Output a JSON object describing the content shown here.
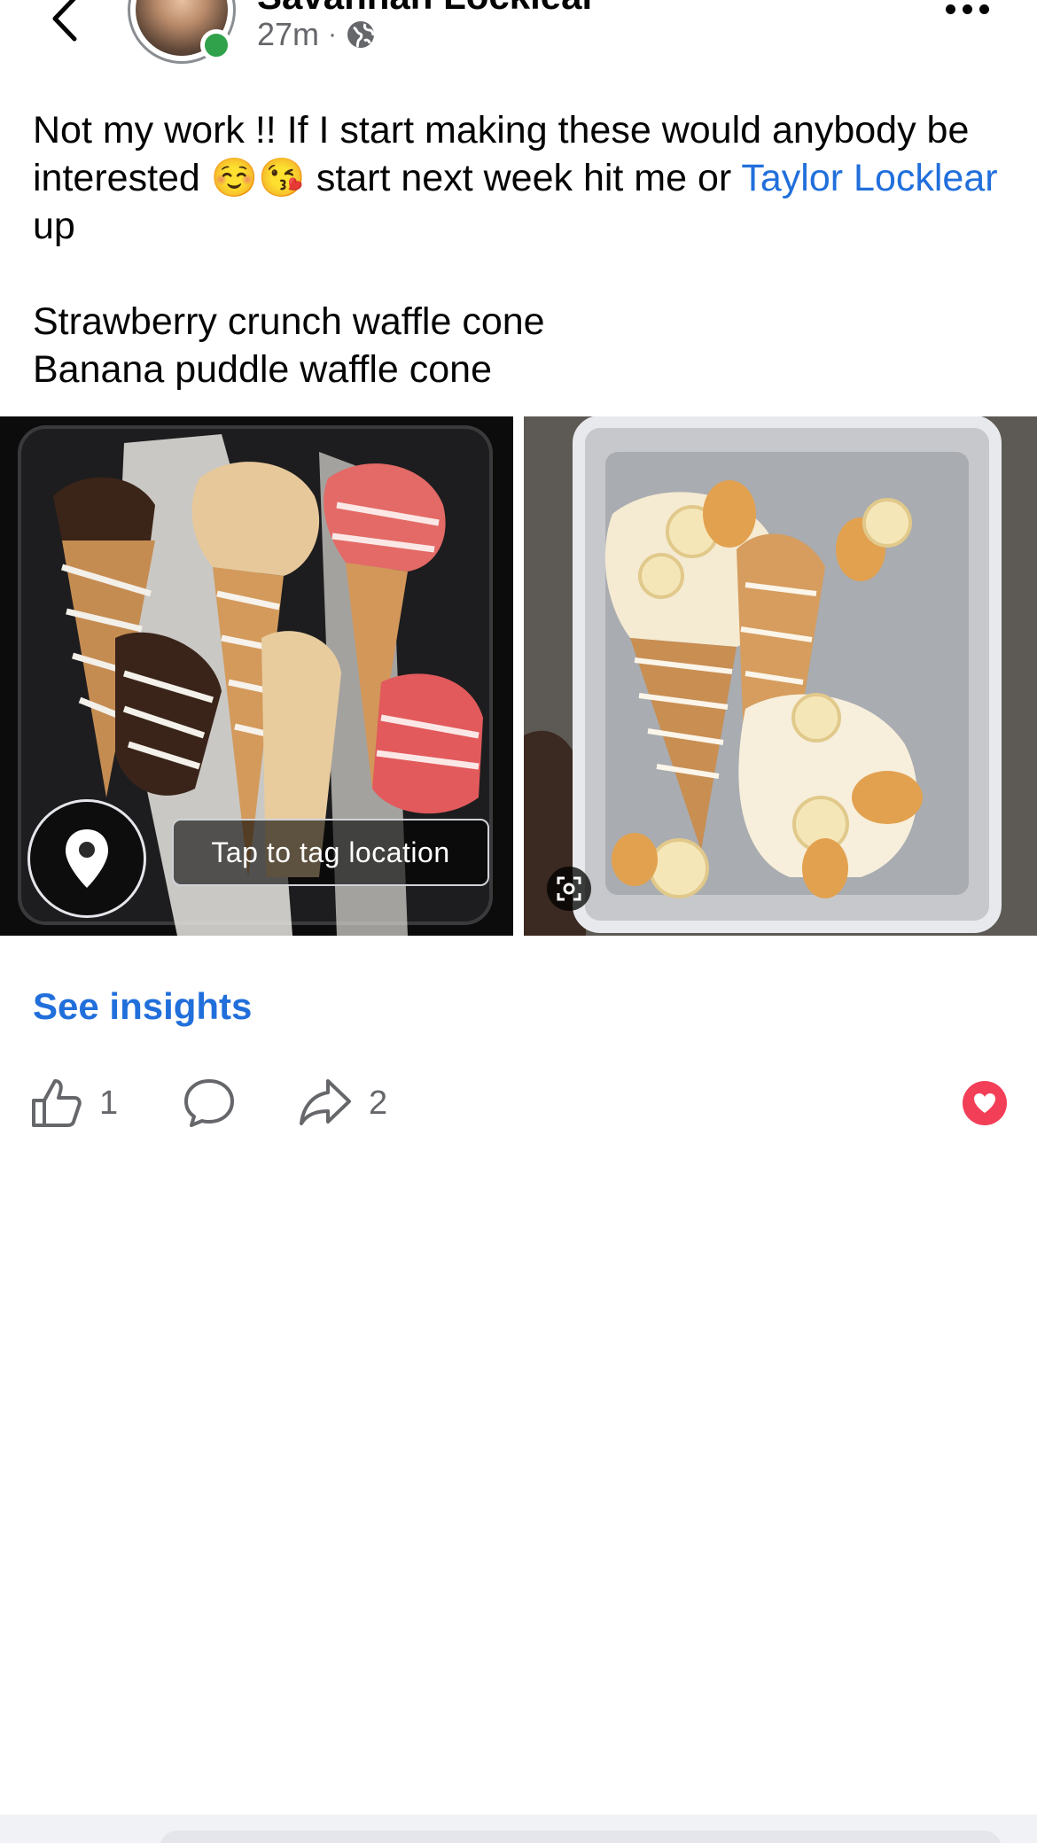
{
  "header": {
    "author_name": "Savannah Locklear",
    "time": "27m",
    "separator": "·",
    "audience_icon": "globe-icon",
    "back_icon": "chevron-left-icon",
    "more_icon": "more-horizontal-icon"
  },
  "post": {
    "text_before_mention": "Not my work !! If I start making these would anybody be interested ☺️😘 start next week hit me or ",
    "mention": "Taylor Locklear",
    "text_after_mention": " up",
    "line2": "Strawberry crunch waffle cone",
    "line3": "Banana puddle waffle cone"
  },
  "photos": {
    "tag_location_label": "Tap to tag location",
    "location_icon": "map-pin-icon",
    "scan_icon": "visual-search-icon"
  },
  "insights": {
    "label": "See insights"
  },
  "actions": {
    "like_count": "1",
    "share_count": "2",
    "like_icon": "thumbs-up-icon",
    "comment_icon": "comment-icon",
    "share_icon": "share-arrow-icon",
    "reaction_icon": "heart-reaction-icon"
  },
  "colors": {
    "link_blue": "#216fdb",
    "online_green": "#31a24c",
    "heart_red": "#f33e58",
    "secondary_text": "#65676b"
  }
}
